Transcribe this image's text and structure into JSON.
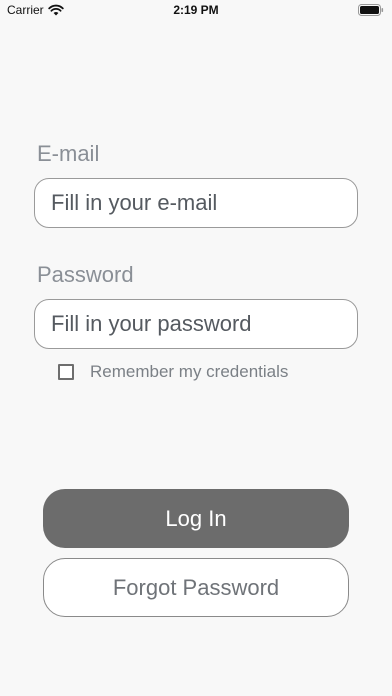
{
  "status_bar": {
    "carrier": "Carrier",
    "time": "2:19 PM"
  },
  "form": {
    "email_label": "E-mail",
    "email_placeholder": "Fill in your e-mail",
    "password_label": "Password",
    "password_placeholder": "Fill in your password",
    "remember_label": "Remember my credentials",
    "remember_checked": false
  },
  "actions": {
    "login_label": "Log In",
    "forgot_label": "Forgot Password"
  },
  "colors": {
    "background": "#f8f8f8",
    "primary_button": "#6c6c6c",
    "label_text": "#8a8f96"
  },
  "icons": {
    "wifi": "wifi-icon",
    "battery": "battery-icon"
  }
}
